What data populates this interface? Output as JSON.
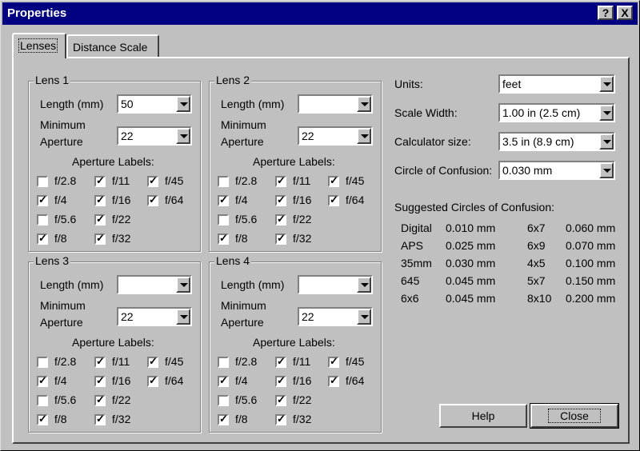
{
  "window": {
    "title": "Properties",
    "help_glyph": "?",
    "close_glyph": "X"
  },
  "tabs": [
    {
      "label": "Lenses"
    },
    {
      "label": "Distance Scale"
    }
  ],
  "lens_common": {
    "length_label": "Length (mm)",
    "min_aperture_label_line1": "Minimum",
    "min_aperture_label_line2": "Aperture",
    "aperture_labels_title": "Aperture Labels:"
  },
  "lenses": [
    {
      "title": "Lens 1",
      "length": "50",
      "min_aperture": "22",
      "apertures": [
        {
          "label": "f/2.8",
          "checked": false
        },
        {
          "label": "f/4",
          "checked": true
        },
        {
          "label": "f/5.6",
          "checked": false
        },
        {
          "label": "f/8",
          "checked": true
        },
        {
          "label": "f/11",
          "checked": true
        },
        {
          "label": "f/16",
          "checked": true
        },
        {
          "label": "f/22",
          "checked": true
        },
        {
          "label": "f/32",
          "checked": true
        },
        {
          "label": "f/45",
          "checked": true
        },
        {
          "label": "f/64",
          "checked": true
        }
      ]
    },
    {
      "title": "Lens 2",
      "length": "",
      "min_aperture": "22",
      "apertures": [
        {
          "label": "f/2.8",
          "checked": false
        },
        {
          "label": "f/4",
          "checked": true
        },
        {
          "label": "f/5.6",
          "checked": false
        },
        {
          "label": "f/8",
          "checked": true
        },
        {
          "label": "f/11",
          "checked": true
        },
        {
          "label": "f/16",
          "checked": true
        },
        {
          "label": "f/22",
          "checked": true
        },
        {
          "label": "f/32",
          "checked": true
        },
        {
          "label": "f/45",
          "checked": true
        },
        {
          "label": "f/64",
          "checked": true
        }
      ]
    },
    {
      "title": "Lens 3",
      "length": "",
      "min_aperture": "22",
      "apertures": [
        {
          "label": "f/2.8",
          "checked": false
        },
        {
          "label": "f/4",
          "checked": true
        },
        {
          "label": "f/5.6",
          "checked": false
        },
        {
          "label": "f/8",
          "checked": true
        },
        {
          "label": "f/11",
          "checked": true
        },
        {
          "label": "f/16",
          "checked": true
        },
        {
          "label": "f/22",
          "checked": true
        },
        {
          "label": "f/32",
          "checked": true
        },
        {
          "label": "f/45",
          "checked": true
        },
        {
          "label": "f/64",
          "checked": true
        }
      ]
    },
    {
      "title": "Lens 4",
      "length": "",
      "min_aperture": "22",
      "apertures": [
        {
          "label": "f/2.8",
          "checked": false
        },
        {
          "label": "f/4",
          "checked": true
        },
        {
          "label": "f/5.6",
          "checked": false
        },
        {
          "label": "f/8",
          "checked": true
        },
        {
          "label": "f/11",
          "checked": true
        },
        {
          "label": "f/16",
          "checked": true
        },
        {
          "label": "f/22",
          "checked": true
        },
        {
          "label": "f/32",
          "checked": true
        },
        {
          "label": "f/45",
          "checked": true
        },
        {
          "label": "f/64",
          "checked": true
        }
      ]
    }
  ],
  "settings": {
    "units": {
      "label": "Units:",
      "value": "feet"
    },
    "scale_width": {
      "label": "Scale Width:",
      "value": "1.00 in  (2.5 cm)"
    },
    "calculator_size": {
      "label": "Calculator size:",
      "value": "3.5 in  (8.9 cm)"
    },
    "circle_of_confusion": {
      "label": "Circle of Confusion:",
      "value": "0.030 mm"
    }
  },
  "suggested": {
    "title": "Suggested Circles of Confusion:",
    "left": [
      {
        "format": "Digital",
        "value": "0.010 mm"
      },
      {
        "format": "APS",
        "value": "0.025 mm"
      },
      {
        "format": "35mm",
        "value": "0.030 mm"
      },
      {
        "format": "645",
        "value": "0.045 mm"
      },
      {
        "format": "6x6",
        "value": "0.045 mm"
      }
    ],
    "right": [
      {
        "format": "6x7",
        "value": "0.060 mm"
      },
      {
        "format": "6x9",
        "value": "0.070 mm"
      },
      {
        "format": "4x5",
        "value": "0.100 mm"
      },
      {
        "format": "5x7",
        "value": "0.150 mm"
      },
      {
        "format": "8x10",
        "value": "0.200 mm"
      }
    ]
  },
  "buttons": {
    "help": "Help",
    "close": "Close"
  }
}
